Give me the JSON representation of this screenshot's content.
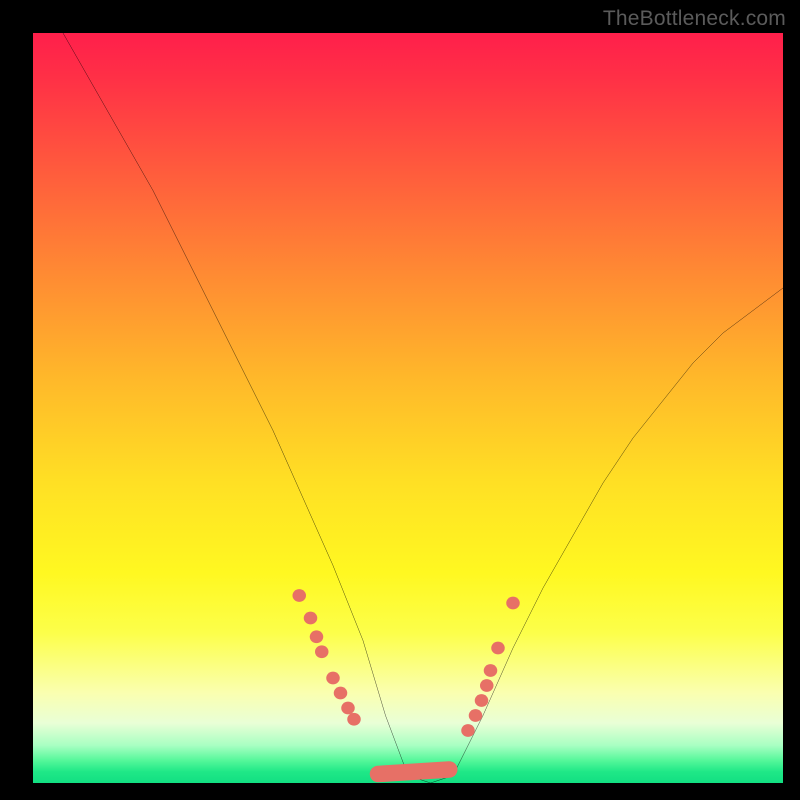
{
  "watermark": "TheBottleneck.com",
  "chart_data": {
    "type": "line",
    "title": "",
    "xlabel": "",
    "ylabel": "",
    "xlim": [
      0,
      100
    ],
    "ylim": [
      0,
      100
    ],
    "series": [
      {
        "name": "bottleneck-curve",
        "x": [
          4,
          8,
          12,
          16,
          20,
          24,
          28,
          32,
          36,
          40,
          44,
          47,
          50,
          53,
          56,
          60,
          64,
          68,
          72,
          76,
          80,
          84,
          88,
          92,
          96,
          100
        ],
        "y": [
          100,
          93,
          86,
          79,
          71,
          63,
          55,
          47,
          38,
          29,
          19,
          9,
          1,
          0,
          1,
          9,
          18,
          26,
          33,
          40,
          46,
          51,
          56,
          60,
          63,
          66
        ]
      }
    ],
    "markers": {
      "left_cluster": [
        [
          35.5,
          25
        ],
        [
          37,
          22
        ],
        [
          37.8,
          19.5
        ],
        [
          38.5,
          17.5
        ],
        [
          40,
          14
        ],
        [
          41,
          12
        ],
        [
          42,
          10
        ],
        [
          42.8,
          8.5
        ]
      ],
      "bottom_cluster": [
        [
          46,
          1.2
        ],
        [
          48,
          0.8
        ],
        [
          50,
          0.7
        ],
        [
          52,
          0.8
        ],
        [
          54,
          1.2
        ],
        [
          55.5,
          1.8
        ]
      ],
      "right_cluster": [
        [
          58,
          7
        ],
        [
          59,
          9
        ],
        [
          59.8,
          11
        ],
        [
          60.5,
          13
        ],
        [
          61,
          15
        ],
        [
          62,
          18
        ],
        [
          64,
          24
        ]
      ]
    },
    "colors": {
      "curve": "#000000",
      "marker": "#e77066",
      "background_top": "#ff1f4b",
      "background_bottom": "#12df82"
    }
  }
}
